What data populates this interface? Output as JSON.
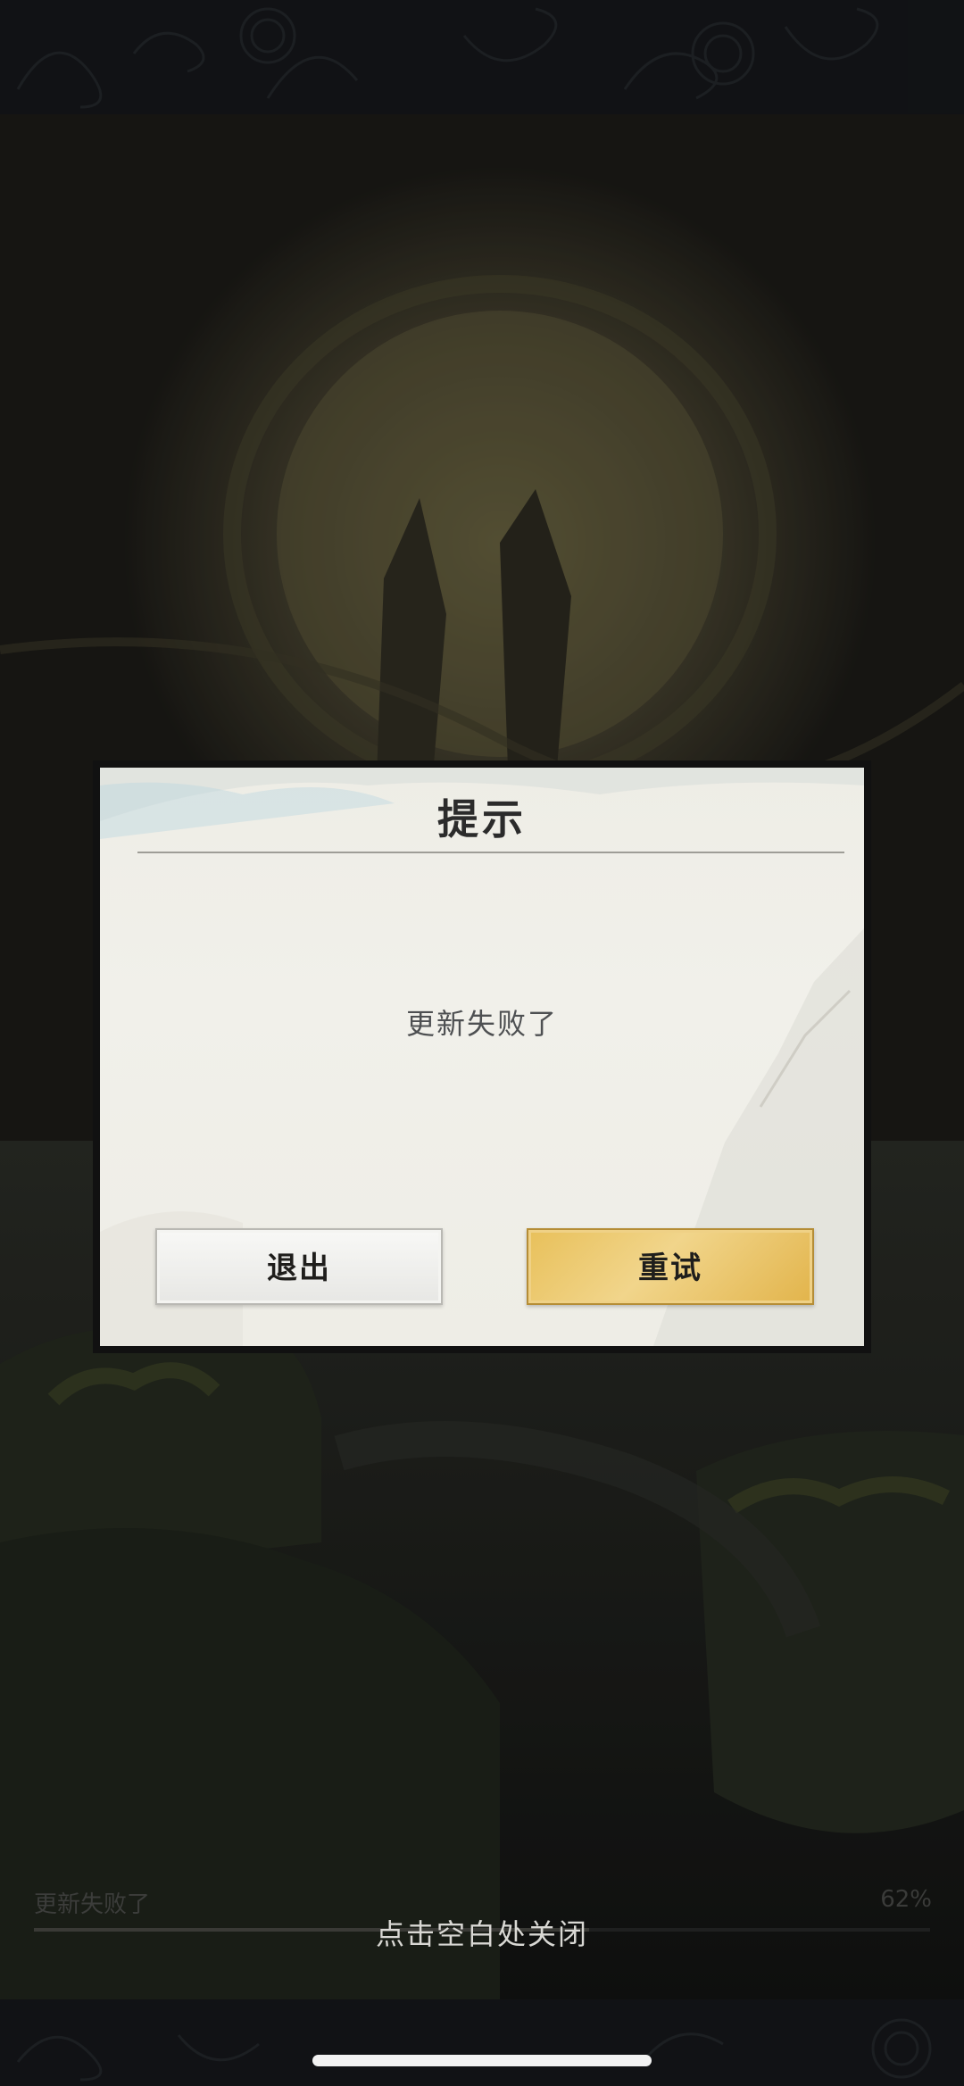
{
  "background": {
    "progress_status": "更新失败了",
    "progress_percent": "62%",
    "progress_fraction": 0.62,
    "tap_to_close_hint": "点击空白处关闭"
  },
  "dialog": {
    "title": "提示",
    "message": "更新失败了",
    "exit_label": "退出",
    "retry_label": "重试"
  },
  "colors": {
    "retry_gold": "#e8c05a",
    "paper": "#f1f0ea",
    "backdrop": "#15171a"
  }
}
